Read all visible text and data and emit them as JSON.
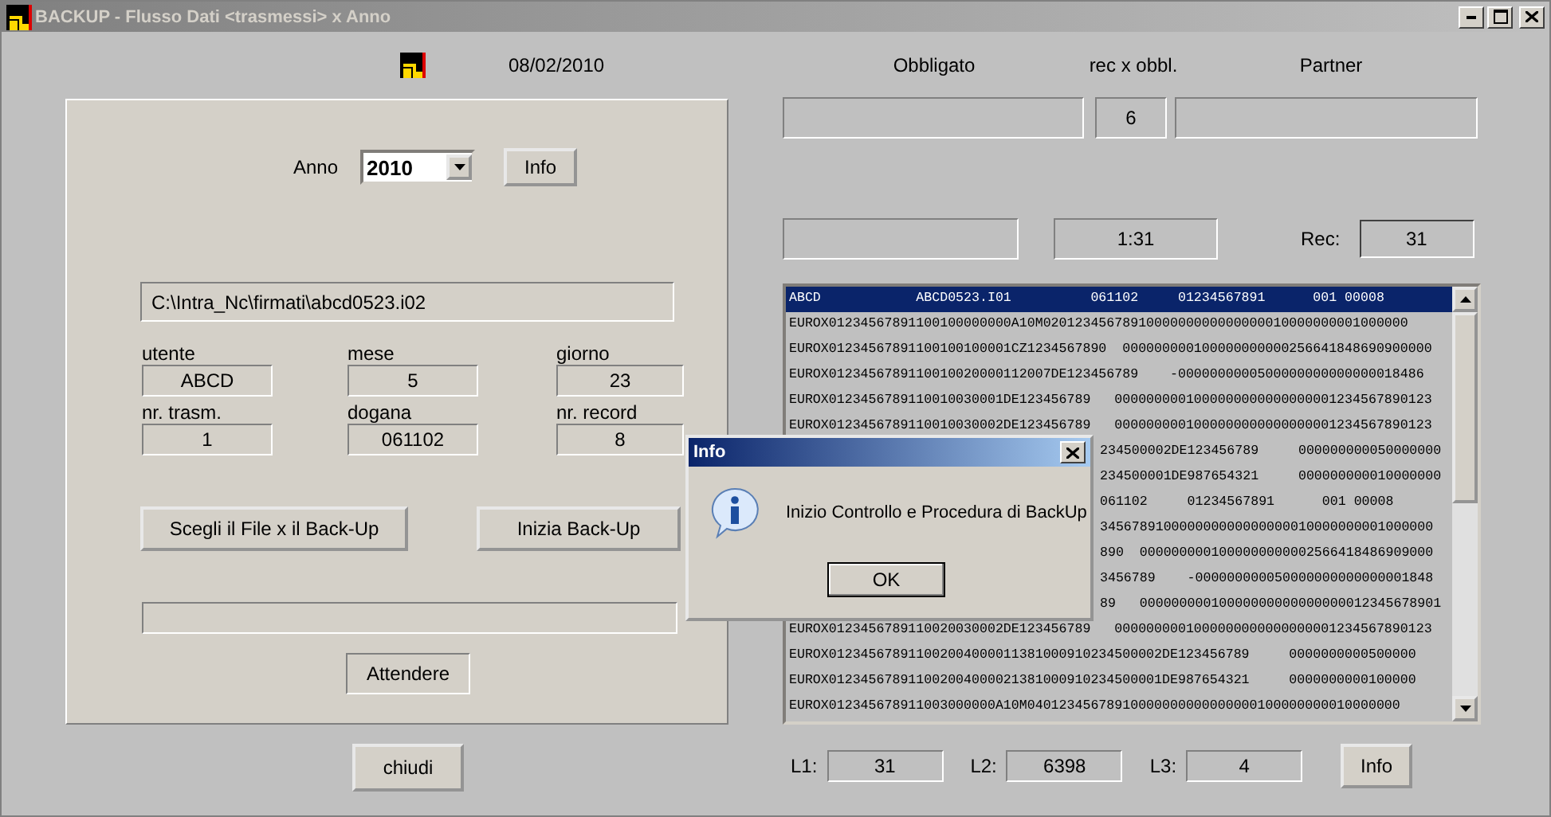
{
  "window": {
    "title": "BACKUP - Flusso Dati <trasmessi> x Anno",
    "date": "08/02/2010"
  },
  "form": {
    "anno_label": "Anno",
    "anno_value": "2010",
    "info_button": "Info",
    "path": "C:\\Intra_Nc\\firmati\\abcd0523.i02",
    "fields": [
      {
        "label": "utente",
        "value": "ABCD"
      },
      {
        "label": "mese",
        "value": "5"
      },
      {
        "label": "giorno",
        "value": "23"
      },
      {
        "label": "nr. trasm.",
        "value": "1"
      },
      {
        "label": "dogana",
        "value": "061102"
      },
      {
        "label": "nr. record",
        "value": "8"
      }
    ],
    "choose_button": "Scegli il File x il Back-Up",
    "start_button": "Inizia Back-Up",
    "status": "Attendere",
    "close_button": "chiudi"
  },
  "summary": {
    "headers": [
      "Obbligato",
      "rec x obbl.",
      "Partner"
    ],
    "rec_x_obbl": "6",
    "time": "1:31",
    "rec_label": "Rec:",
    "rec": "31"
  },
  "records": [
    {
      "text": "ABCD            ABCD0523.I01          061102     01234567891      001 00008",
      "selected": true,
      "kind": "full"
    },
    {
      "text": "EUROX01234567891100100000000A10M0201234567891000000000000000010000000001000000",
      "selected": false,
      "kind": "full"
    },
    {
      "text": "EUROX01234567891100100100001CZ1234567890  000000000100000000000256641848690900000",
      "selected": false,
      "kind": "full"
    },
    {
      "text": "EUROX0123456789110010020000112007DE123456789    -0000000000500000000000000018486",
      "selected": false,
      "kind": "full"
    },
    {
      "text": "EUROX0123456789110010030001DE123456789   0000000001000000000000000001234567890123",
      "selected": false,
      "kind": "full"
    },
    {
      "text": "EUROX0123456789110010030002DE123456789   0000000001000000000000000001234567890123",
      "selected": false,
      "kind": "full"
    },
    {
      "text": "234500002DE123456789     000000000050000000",
      "selected": false,
      "kind": "covered"
    },
    {
      "text": "234500001DE987654321     000000000010000000",
      "selected": false,
      "kind": "covered"
    },
    {
      "text": "061102     01234567891      001 00008",
      "selected": false,
      "kind": "covered"
    },
    {
      "text": "345678910000000000000000010000000001000000",
      "selected": false,
      "kind": "covered"
    },
    {
      "text": "890  0000000001000000000002566418486909000",
      "selected": false,
      "kind": "covered"
    },
    {
      "text": "3456789    -000000000050000000000000001848",
      "selected": false,
      "kind": "covered"
    },
    {
      "text": "89   00000000010000000000000000012345678901",
      "selected": false,
      "kind": "covered"
    },
    {
      "text": "EUROX0123456789110020030002DE123456789   0000000001000000000000000001234567890123",
      "selected": false,
      "kind": "full"
    },
    {
      "text": "EUROX012345678911002004000011381000910234500002DE123456789     0000000000500000",
      "selected": false,
      "kind": "full"
    },
    {
      "text": "EUROX012345678911002004000021381000910234500001DE987654321     0000000000100000",
      "selected": false,
      "kind": "full"
    },
    {
      "text": "EUROX012345678911003000000A10M04012345678910000000000000000100000000010000000",
      "selected": false,
      "kind": "full"
    }
  ],
  "counters": [
    {
      "label": "L1:",
      "value": "31"
    },
    {
      "label": "L2:",
      "value": "6398"
    },
    {
      "label": "L3:",
      "value": "4"
    }
  ],
  "counters_info_button": "Info",
  "dialog": {
    "title": "Info",
    "message": "Inizio Controllo e Procedura di BackUp",
    "ok_button": "OK"
  }
}
